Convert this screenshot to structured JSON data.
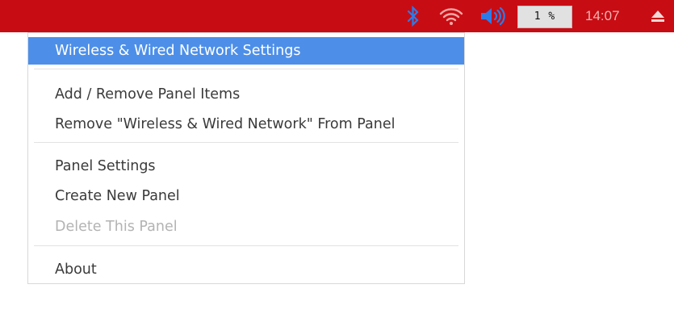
{
  "taskbar": {
    "background_color": "#c80c14",
    "icons": {
      "bluetooth": "bluetooth-icon",
      "wifi": "wifi-icon",
      "volume": "volume-icon",
      "eject": "eject-icon"
    },
    "cpu_usage": "1 %",
    "clock": "14:07"
  },
  "context_menu": {
    "selected_color": "#4d8fe8",
    "items": [
      {
        "label": "Wireless & Wired Network Settings",
        "state": "selected"
      },
      {
        "label": "Add / Remove Panel Items",
        "state": "enabled"
      },
      {
        "label": "Remove \"Wireless & Wired Network\" From Panel",
        "state": "enabled"
      },
      {
        "label": "Panel Settings",
        "state": "enabled"
      },
      {
        "label": "Create New Panel",
        "state": "enabled"
      },
      {
        "label": "Delete This Panel",
        "state": "disabled"
      },
      {
        "label": "About",
        "state": "enabled"
      }
    ]
  }
}
